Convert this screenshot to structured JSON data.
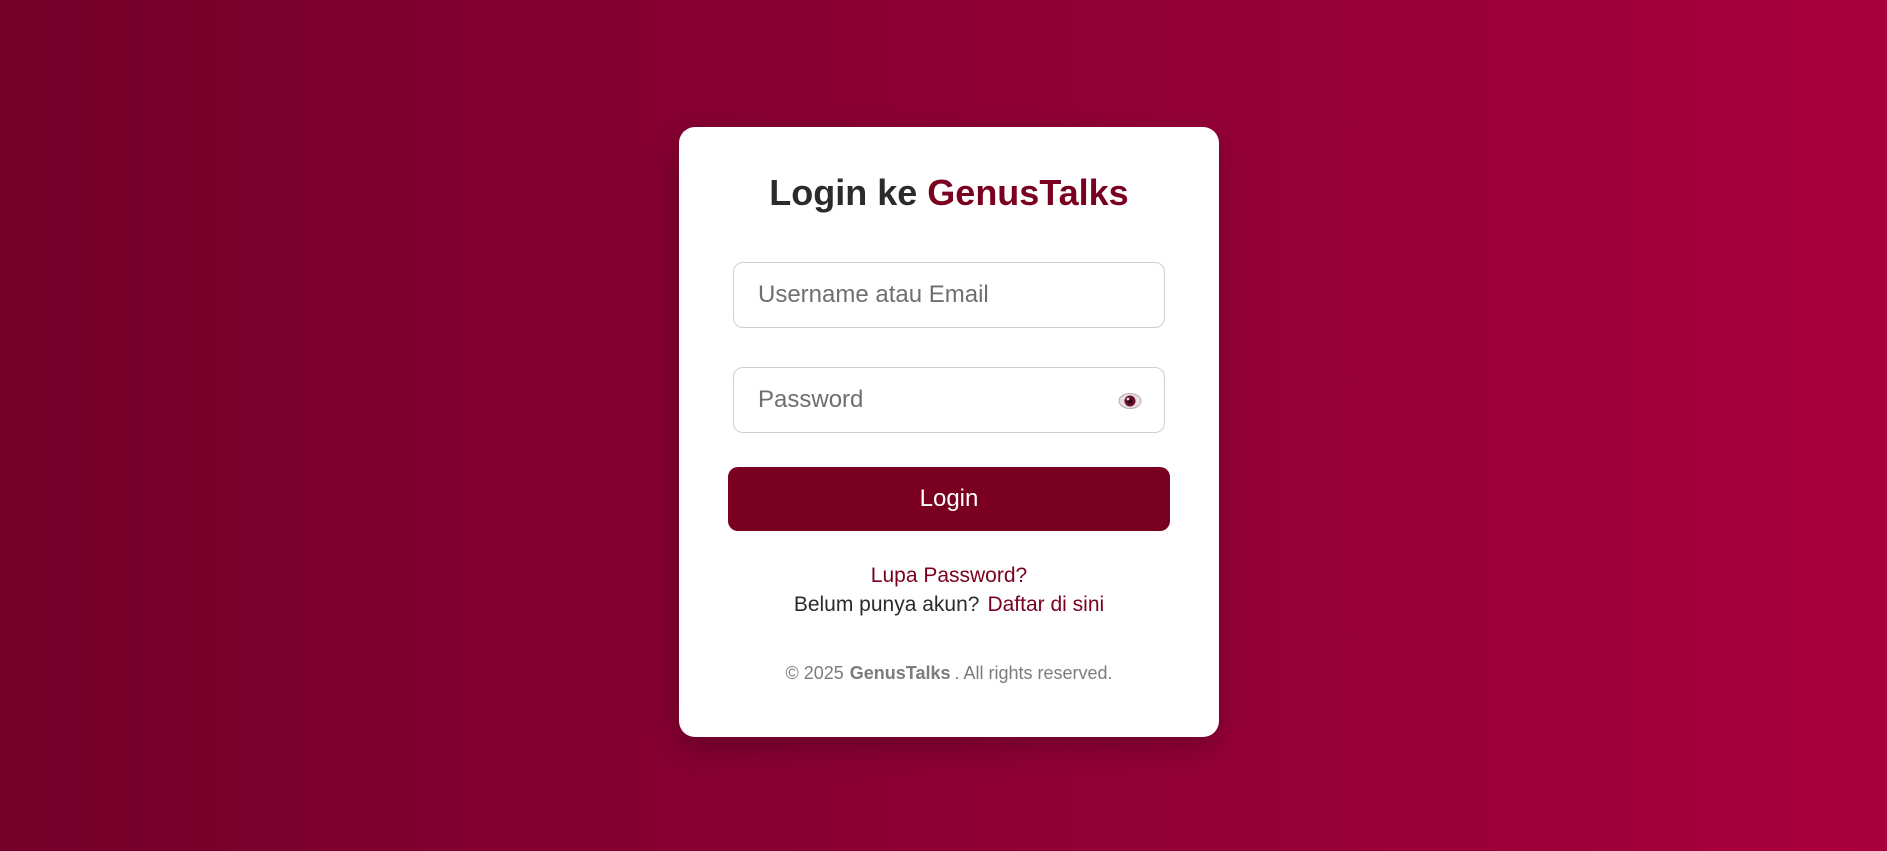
{
  "login": {
    "title_prefix": "Login ke",
    "title_brand": "GenusTalks",
    "username_placeholder": "Username atau Email",
    "password_placeholder": "Password",
    "password_toggle_icon": "eye-icon",
    "login_button": "Login",
    "forgot_password_link": "Lupa Password?",
    "register_question": "Belum punya akun?",
    "register_link": "Daftar di sini"
  },
  "footer": {
    "copyright": "© 2025",
    "brand": "GenusTalks",
    "rights": ". All rights reserved."
  },
  "colors": {
    "brand": "#7a0020",
    "background_start": "#75002a",
    "background_end": "#a8003f",
    "card": "#ffffff"
  }
}
